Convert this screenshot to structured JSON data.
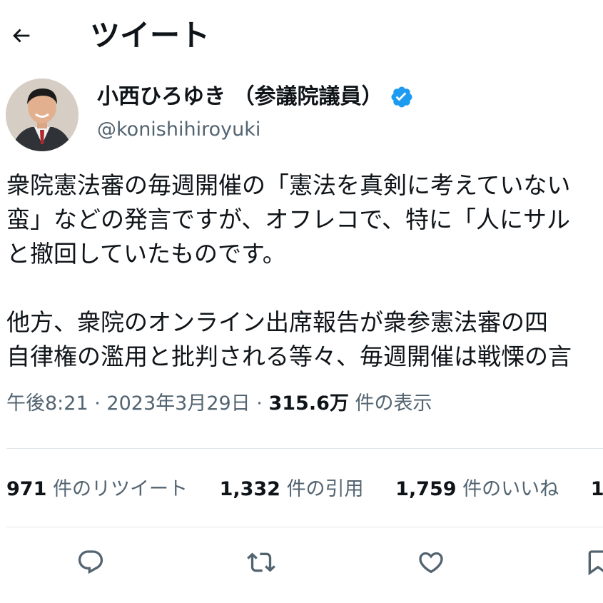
{
  "header": {
    "title": "ツイート",
    "back_icon": "arrow-left-icon"
  },
  "author": {
    "name": "小西ひろゆき （参議院議員）",
    "handle": "@konishihiroyuki",
    "verified_icon": "verified-badge-icon",
    "verified_color": "#1d9bf0"
  },
  "tweet": {
    "lines": [
      "衆院憲法審の毎週開催の「憲法を真剣に考えていない",
      "蛮」などの発言ですが、オフレコで、特に「人にサル",
      "と撤回していたものです。",
      "他方、衆院のオンライン出席報告が衆参憲法審の四",
      "自律権の濫用と批判される等々、毎週開催は戦慄の言"
    ]
  },
  "meta": {
    "time": "午後8:21",
    "date": "2023年3月29日",
    "separator": "·",
    "views_count": "315.6万",
    "views_label": "件の表示"
  },
  "stats": {
    "retweets_count": "971",
    "retweets_label": "件のリツイート",
    "quotes_count": "1,332",
    "quotes_label": "件の引用",
    "likes_count": "1,759",
    "likes_label": "件のいいね",
    "next_count": "1"
  },
  "actions": {
    "reply_icon": "reply-icon",
    "retweet_icon": "retweet-icon",
    "like_icon": "heart-icon",
    "bookmark_icon": "bookmark-icon"
  },
  "colors": {
    "text_primary": "#0f1419",
    "text_secondary": "#536471",
    "divider": "#e1e6ea",
    "accent": "#1d9bf0"
  }
}
